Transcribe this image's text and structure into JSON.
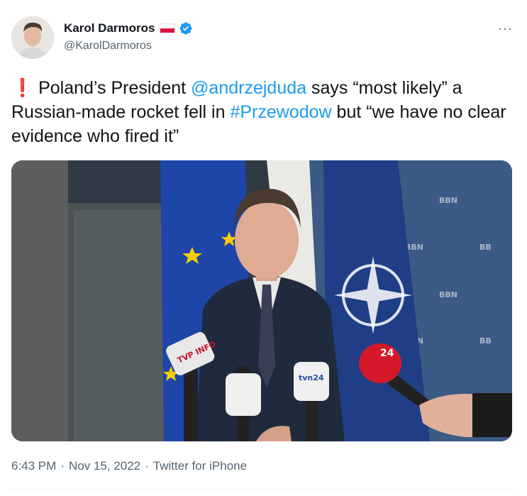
{
  "author": {
    "name": "Karol Darmoros",
    "handle": "@KarolDarmoros",
    "flag_icon": "poland-flag-icon",
    "verified_icon": "verified-badge-icon"
  },
  "more_label": "···",
  "tweet": {
    "excl": "❗",
    "text_1": " Poland’s President ",
    "mention": "@andrzejduda",
    "text_2": " says “most likely” a Russian-made rocket fell in ",
    "hashtag": "#Przewodow",
    "text_3": " but “we have no clear evidence who fired it”"
  },
  "media": {
    "mic_label_tvp": "TVP INFO",
    "mic_label_tvn": "tvn24",
    "mic_label_polsat": "24"
  },
  "meta": {
    "time": "6:43 PM",
    "sep1": "·",
    "date": "Nov 15, 2022",
    "sep2": "·",
    "source": "Twitter for iPhone"
  },
  "colors": {
    "accent": "#1d9bf0",
    "text": "#0f1419",
    "muted": "#536471"
  }
}
